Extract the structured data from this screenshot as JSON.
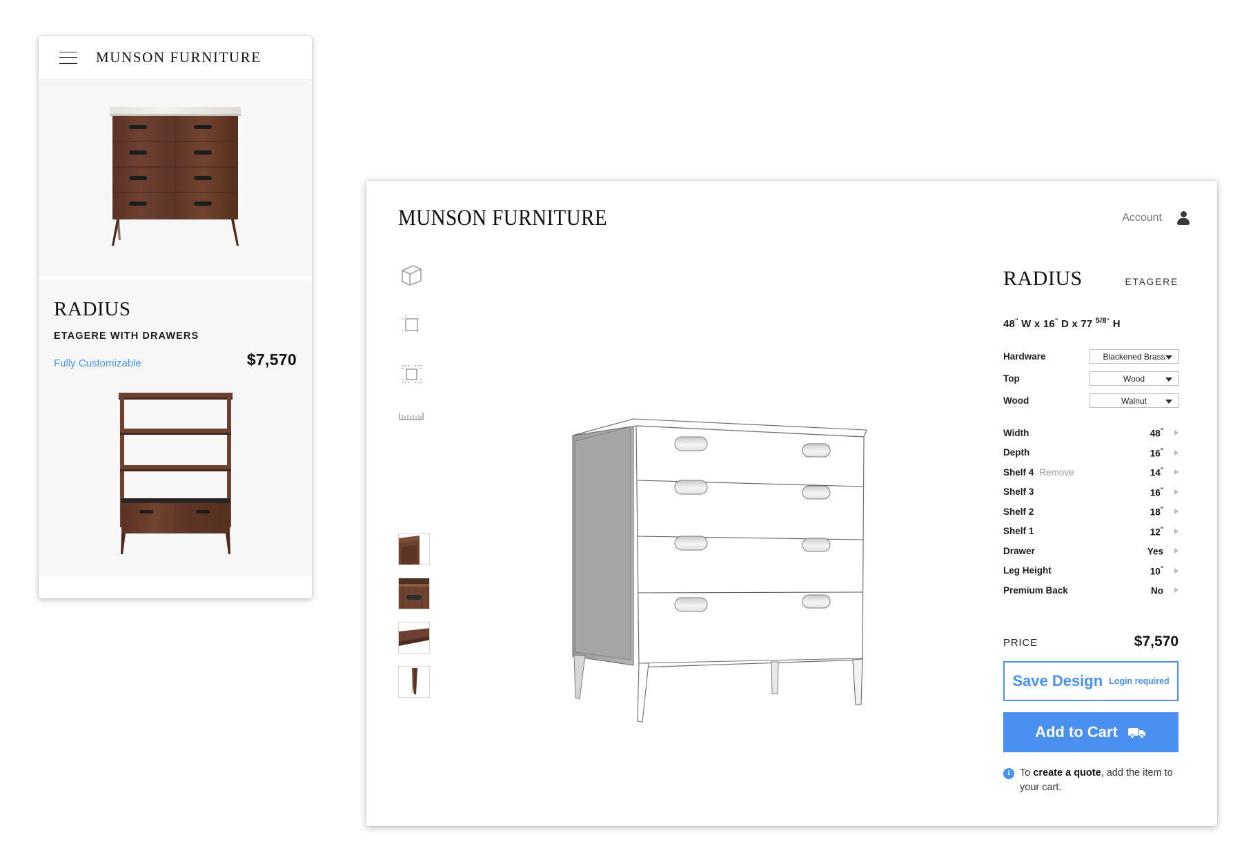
{
  "mobile": {
    "menu_icon": "hamburger-icon",
    "brand": "MUNSON FURNITURE",
    "hero_image_alt": "walnut-four-drawer-dresser",
    "product": {
      "title": "RADIUS",
      "subtitle": "ETAGERE WITH DRAWERS",
      "custom_label": "Fully Customizable",
      "price": "$7,570"
    },
    "shelf_image_alt": "walnut-etagere-with-drawers"
  },
  "desktop": {
    "brand": "MUNSON FURNITURE",
    "account": {
      "label": "Account",
      "icon": "person-icon"
    },
    "tools": [
      {
        "name": "cube-3d-icon"
      },
      {
        "name": "front-view-icon"
      },
      {
        "name": "plan-view-icon"
      },
      {
        "name": "ruler-icon"
      }
    ],
    "thumbnails": [
      {
        "name": "thumbnail-corner-detail"
      },
      {
        "name": "thumbnail-drawer-pull"
      },
      {
        "name": "thumbnail-edge-profile"
      },
      {
        "name": "thumbnail-leg-detail"
      }
    ],
    "viewer": {
      "model_alt": "radius-etagere-line-drawing"
    },
    "product": {
      "title": "RADIUS",
      "kind": "ETAGERE",
      "dimensions": {
        "width": "48",
        "depth": "16",
        "height_whole": "77",
        "height_fraction": "5/8",
        "full": "48\" W x 16\" D x 77 5/8\" H"
      }
    },
    "options": [
      {
        "label": "Hardware",
        "value": "Blackened Brass"
      },
      {
        "label": "Top",
        "value": "Wood"
      },
      {
        "label": "Wood",
        "value": "Walnut"
      }
    ],
    "specs": [
      {
        "label": "Width",
        "remove": "",
        "value": "48",
        "unit": "\""
      },
      {
        "label": "Depth",
        "remove": "",
        "value": "16",
        "unit": "\""
      },
      {
        "label": "Shelf 4",
        "remove": "Remove",
        "value": "14",
        "unit": "\""
      },
      {
        "label": "Shelf 3",
        "remove": "",
        "value": "16",
        "unit": "\""
      },
      {
        "label": "Shelf 2",
        "remove": "",
        "value": "18",
        "unit": "\""
      },
      {
        "label": "Shelf 1",
        "remove": "",
        "value": "12",
        "unit": "\""
      },
      {
        "label": "Drawer",
        "remove": "",
        "value": "Yes",
        "unit": ""
      },
      {
        "label": "Leg Height",
        "remove": "",
        "value": "10",
        "unit": "\""
      },
      {
        "label": "Premium Back",
        "remove": "",
        "value": "No",
        "unit": ""
      }
    ],
    "price": {
      "label": "PRICE",
      "value": "$7,570"
    },
    "save_button": {
      "label": "Save Design",
      "note": "Login required"
    },
    "cart_button": {
      "label": "Add to Cart",
      "icon": "truck-icon"
    },
    "quote_note": {
      "prefix": "To ",
      "bold": "create a quote",
      "suffix": ", add the item to your cart."
    }
  },
  "colors": {
    "accent": "#4a90f0",
    "walnut": "#6b4131",
    "panel_bg": "#f7f7f7",
    "text": "#111111"
  }
}
